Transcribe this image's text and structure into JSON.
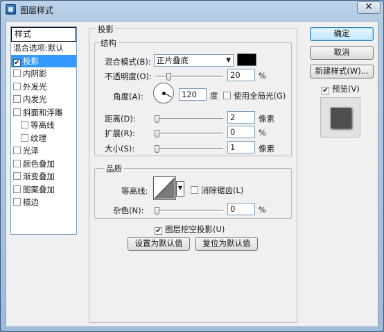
{
  "window": {
    "title": "图层样式",
    "close_label": "✕"
  },
  "styles": {
    "header": "样式",
    "items": [
      {
        "label": "混合选项:默认",
        "checkbox": false,
        "checked": false,
        "selected": false,
        "indent": false
      },
      {
        "label": "投影",
        "checkbox": true,
        "checked": true,
        "selected": true,
        "indent": false
      },
      {
        "label": "内阴影",
        "checkbox": true,
        "checked": false,
        "selected": false,
        "indent": false
      },
      {
        "label": "外发光",
        "checkbox": true,
        "checked": false,
        "selected": false,
        "indent": false
      },
      {
        "label": "内发光",
        "checkbox": true,
        "checked": false,
        "selected": false,
        "indent": false
      },
      {
        "label": "斜面和浮雕",
        "checkbox": true,
        "checked": false,
        "selected": false,
        "indent": false
      },
      {
        "label": "等高线",
        "checkbox": true,
        "checked": false,
        "selected": false,
        "indent": true
      },
      {
        "label": "纹理",
        "checkbox": true,
        "checked": false,
        "selected": false,
        "indent": true
      },
      {
        "label": "光泽",
        "checkbox": true,
        "checked": false,
        "selected": false,
        "indent": false
      },
      {
        "label": "颜色叠加",
        "checkbox": true,
        "checked": false,
        "selected": false,
        "indent": false
      },
      {
        "label": "渐变叠加",
        "checkbox": true,
        "checked": false,
        "selected": false,
        "indent": false
      },
      {
        "label": "图案叠加",
        "checkbox": true,
        "checked": false,
        "selected": false,
        "indent": false
      },
      {
        "label": "描边",
        "checkbox": true,
        "checked": false,
        "selected": false,
        "indent": false
      }
    ]
  },
  "drop_shadow": {
    "title": "投影",
    "structure": {
      "title": "结构",
      "blend_mode_label": "混合模式(B):",
      "blend_mode_value": "正片叠底",
      "blend_color": "#000000",
      "opacity_label": "不透明度(O):",
      "opacity_value": "20",
      "opacity_unit": "%",
      "opacity_level": 0.2,
      "angle_label": "角度(A):",
      "angle_value": "120",
      "angle_unit": "度",
      "global_light_label": "使用全局光(G)",
      "global_light_checked": false,
      "distance_label": "距离(D):",
      "distance_value": "2",
      "distance_unit": "像素",
      "spread_label": "扩展(R):",
      "spread_value": "0",
      "spread_unit": "%",
      "size_label": "大小(S):",
      "size_value": "1",
      "size_unit": "像素"
    },
    "quality": {
      "title": "品质",
      "contour_label": "等高线:",
      "anti_alias_label": "消除锯齿(L)",
      "anti_alias_checked": false,
      "noise_label": "杂色(N):",
      "noise_value": "0",
      "noise_unit": "%"
    },
    "knockout_label": "图层挖空投影(U)",
    "knockout_checked": true,
    "make_default_label": "设置为默认值",
    "reset_default_label": "复位为默认值"
  },
  "buttons": {
    "ok": "确定",
    "cancel": "取消",
    "new_style": "新建样式(W)...",
    "preview_label": "预览(V)",
    "preview_checked": true
  },
  "check_glyph": "✔"
}
